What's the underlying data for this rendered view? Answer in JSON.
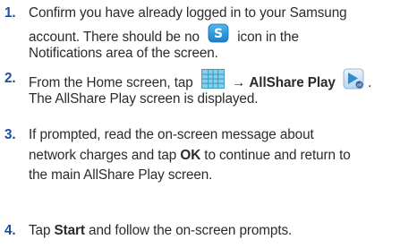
{
  "steps": [
    {
      "number": "1.",
      "line1": "Confirm you have already logged in to your Samsung",
      "line2_before": "account. There should be no",
      "line2_after": "icon in the",
      "line3": "Notifications area of the screen.",
      "icon": "samsung-account-icon"
    },
    {
      "number": "2.",
      "line1_before": "From the Home screen, tap",
      "arrow": "→",
      "line1_bold": "AllShare Play",
      "line1_end": ".",
      "line2": "The AllShare Play screen is displayed.",
      "icons": [
        "apps-grid-icon",
        "allshare-play-icon"
      ]
    },
    {
      "number": "3.",
      "line1": "If prompted, read the on-screen message about",
      "line2_before": "network charges and tap",
      "line2_bold": "OK",
      "line2_after": "to continue and return to",
      "line3": "the main AllShare Play screen."
    },
    {
      "number": "4.",
      "line1_before": "Tap",
      "line1_bold": "Start",
      "line1_after": "and follow the on-screen prompts."
    }
  ],
  "colors": {
    "step_number": "#1f4f9c",
    "text": "#2b2b2b"
  }
}
